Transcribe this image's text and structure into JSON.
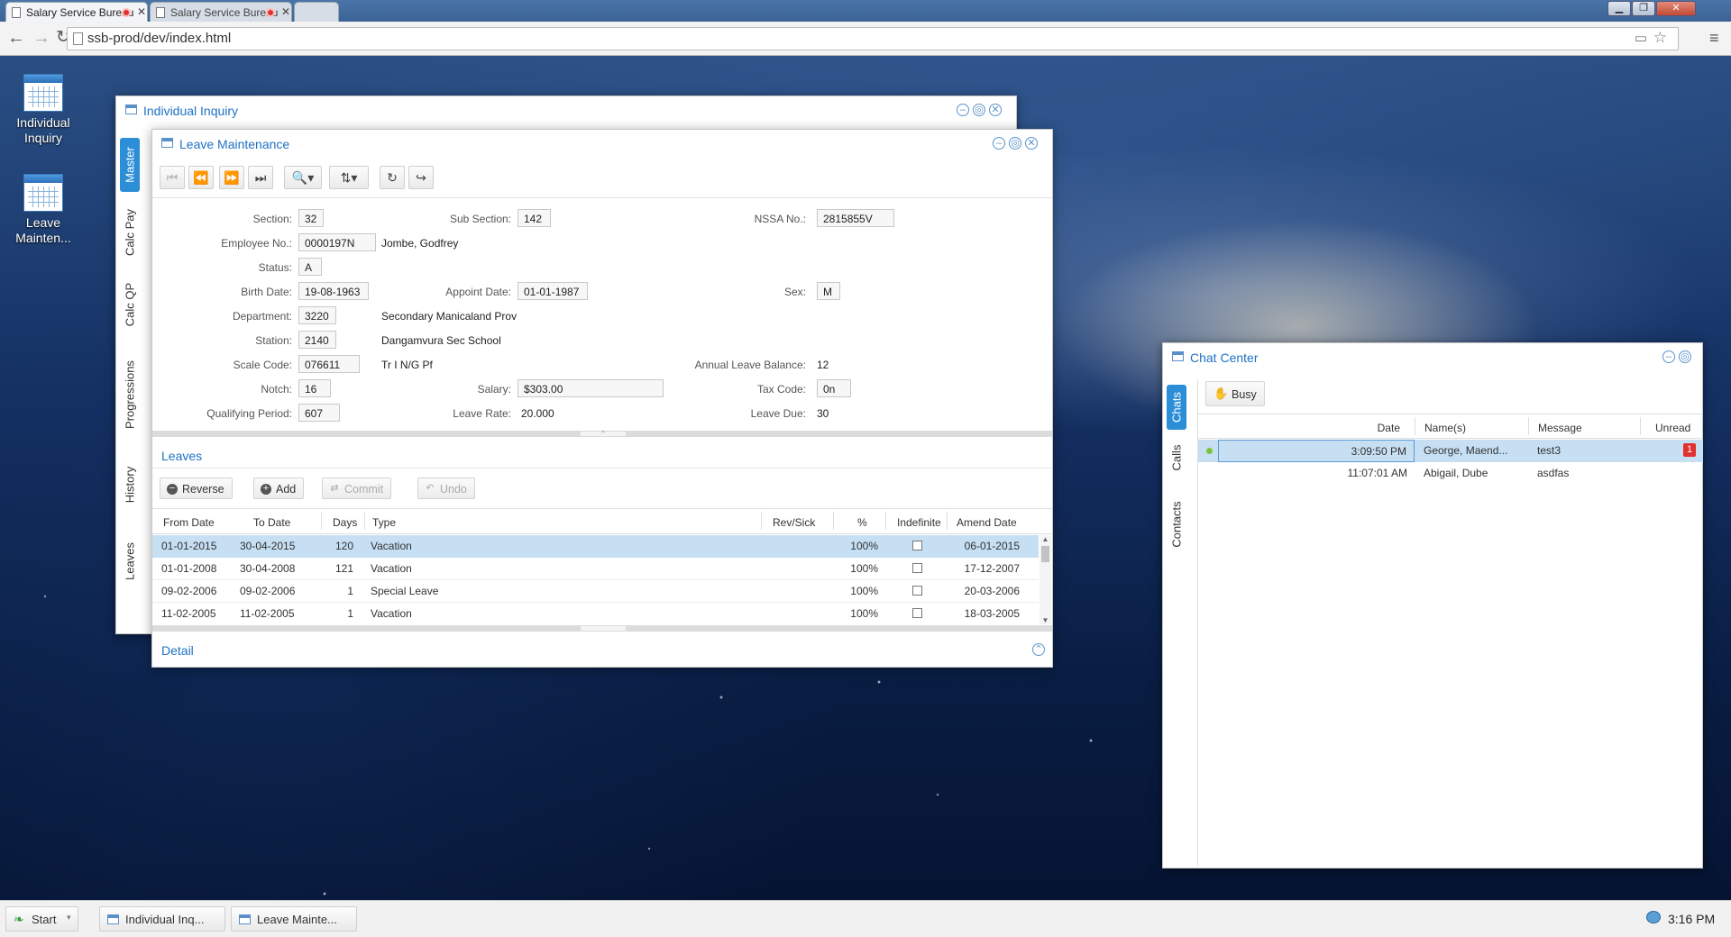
{
  "browser": {
    "tabs": [
      {
        "title": "Salary Service Bureau",
        "active": true
      },
      {
        "title": "Salary Service Bureau",
        "active": false
      }
    ],
    "url": "ssb-prod/dev/index.html"
  },
  "desktop": {
    "icons": [
      {
        "label": "Individual Inquiry"
      },
      {
        "label": "Leave Mainten..."
      }
    ]
  },
  "individual_inquiry": {
    "title": "Individual Inquiry",
    "vtabs": [
      "Master",
      "Calc Pay",
      "Calc QP",
      "Progressions",
      "History",
      "Leaves"
    ]
  },
  "leave_maintenance": {
    "title": "Leave Maintenance",
    "fields": {
      "section_label": "Section:",
      "section": "32",
      "subsection_label": "Sub Section:",
      "subsection": "142",
      "nssa_label": "NSSA No.:",
      "nssa": "2815855V",
      "employee_label": "Employee No.:",
      "employee": "0000197N",
      "employee_name": "Jombe, Godfrey",
      "status_label": "Status:",
      "status": "A",
      "birth_label": "Birth Date:",
      "birth": "19-08-1963",
      "appoint_label": "Appoint Date:",
      "appoint": "01-01-1987",
      "sex_label": "Sex:",
      "sex": "M",
      "dept_label": "Department:",
      "dept": "3220",
      "dept_name": "Secondary Manicaland Prov",
      "station_label": "Station:",
      "station": "2140",
      "station_name": "Dangamvura Sec School",
      "scale_label": "Scale Code:",
      "scale": "076611",
      "scale_name": "Tr I N/G Pf",
      "alb_label": "Annual Leave Balance:",
      "alb": "12",
      "notch_label": "Notch:",
      "notch": "16",
      "salary_label": "Salary:",
      "salary": "$303.00",
      "tax_label": "Tax Code:",
      "tax": "0n",
      "qp_label": "Qualifying Period:",
      "qp": "607",
      "rate_label": "Leave Rate:",
      "rate": "20.000",
      "due_label": "Leave Due:",
      "due": "30"
    },
    "leaves": {
      "title": "Leaves",
      "actions": {
        "reverse": "Reverse",
        "add": "Add",
        "commit": "Commit",
        "undo": "Undo"
      },
      "columns": [
        "From Date",
        "To Date",
        "Days",
        "Type",
        "Rev/Sick",
        "%",
        "Indefinite",
        "Amend Date"
      ],
      "rows": [
        {
          "from": "01-01-2015",
          "to": "30-04-2015",
          "days": "120",
          "type": "Vacation",
          "rev": "",
          "pct": "100%",
          "amend": "06-01-2015"
        },
        {
          "from": "01-01-2008",
          "to": "30-04-2008",
          "days": "121",
          "type": "Vacation",
          "rev": "",
          "pct": "100%",
          "amend": "17-12-2007"
        },
        {
          "from": "09-02-2006",
          "to": "09-02-2006",
          "days": "1",
          "type": "Special Leave",
          "rev": "",
          "pct": "100%",
          "amend": "20-03-2006"
        },
        {
          "from": "11-02-2005",
          "to": "11-02-2005",
          "days": "1",
          "type": "Vacation",
          "rev": "",
          "pct": "100%",
          "amend": "18-03-2005"
        }
      ]
    },
    "detail_label": "Detail"
  },
  "chat_center": {
    "title": "Chat Center",
    "vtabs": [
      "Chats",
      "Calls",
      "Contacts"
    ],
    "busy_label": "Busy",
    "columns": [
      "Date",
      "Name(s)",
      "Message",
      "Unread"
    ],
    "rows": [
      {
        "date": "3:09:50 PM",
        "names": "George, Maend...",
        "message": "test3",
        "unread": "1"
      },
      {
        "date": "11:07:01 AM",
        "names": "Abigail, Dube",
        "message": "asdfas",
        "unread": ""
      }
    ]
  },
  "taskbar": {
    "start": "Start",
    "items": [
      "Individual Inq...",
      "Leave Mainte..."
    ],
    "clock": "3:16 PM"
  },
  "colors": {
    "accent": "#1f72c4",
    "selected_row": "#c6dff3",
    "unread_badge": "#e03030"
  }
}
